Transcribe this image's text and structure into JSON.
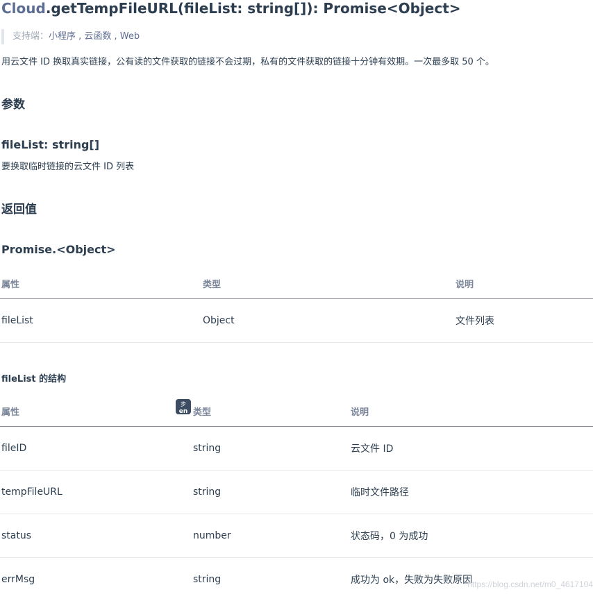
{
  "title": {
    "class_name": "Cloud",
    "signature": ".getTempFileURL(fileList: string[]): Promise<Object>"
  },
  "support": {
    "label": "支持端：",
    "platforms": "小程序 , 云函数 , Web"
  },
  "description": "用云文件 ID 换取真实链接，公有读的文件获取的链接不会过期，私有的文件获取的链接十分钟有效期。一次最多取 50 个。",
  "params": {
    "heading": "参数",
    "param_name": "fileList: string[]",
    "param_desc": "要换取临时链接的云文件 ID 列表"
  },
  "returns": {
    "heading": "返回值",
    "type_heading": "Promise.<Object>",
    "table": {
      "headers": [
        "属性",
        "类型",
        "说明"
      ],
      "rows": [
        [
          "fileList",
          "Object",
          "文件列表"
        ]
      ]
    }
  },
  "filelist_struct": {
    "heading": "fileList 的结构",
    "table": {
      "headers": [
        "属性",
        "类型",
        "说明"
      ],
      "rows": [
        [
          "fileID",
          "string",
          "云文件 ID"
        ],
        [
          "tempFileURL",
          "string",
          "临时文件路径"
        ],
        [
          "status",
          "number",
          "状态码，0 为成功"
        ],
        [
          "errMsg",
          "string",
          "成功为 ok，失败为失败原因"
        ]
      ]
    }
  },
  "translate_icon": {
    "icon": "translate-icon",
    "top_text": "步",
    "bottom_text": "en"
  },
  "watermark": "https://blog.csdn.net/m0_4617104"
}
